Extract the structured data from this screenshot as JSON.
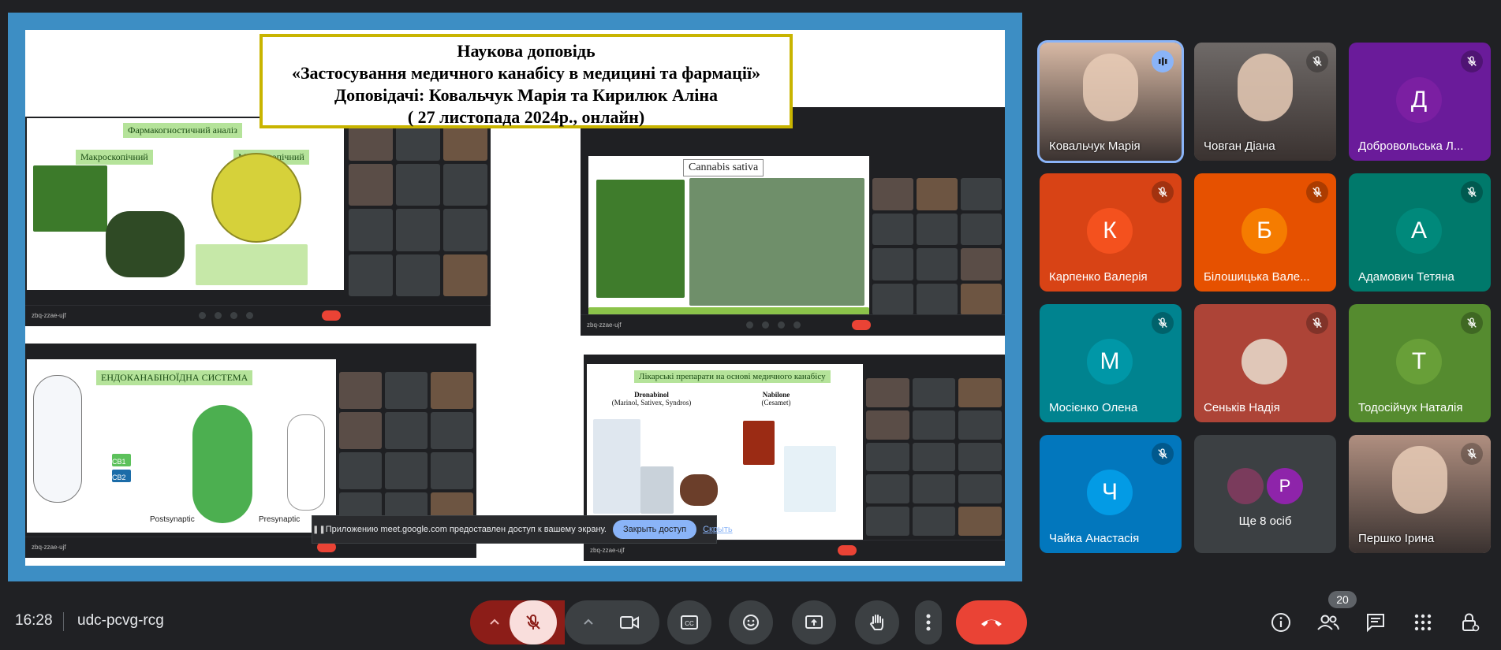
{
  "presentation": {
    "title_lines": [
      "Наукова доповідь",
      "«Застосування медичного канабісу в медицині та фармації»",
      "Доповідачі: Ковальчук Марія та Кирилюк Аліна",
      "( 27 листопада 2024р., онлайн)"
    ],
    "panel_labels": {
      "p1_title": "Фармакогностичний аналіз",
      "p1_macro": "Макроскопічний",
      "p1_micro": "Мікроскопічний",
      "p2_title": "Cannabis sativa",
      "p3_title": "ЕНДОКАНАБІНОЇДНА СИСТЕМА",
      "p3_cb1": "CB1",
      "p3_cb2": "CB2",
      "p3_post": "Postsynaptic",
      "p3_pre": "Presynaptic",
      "p4_title": "Лікарські препарати на основі медичного канабісу",
      "p4_drug1": "Dronabinol",
      "p4_drug1_sub": "(Marinol, Sativex, Syndros)",
      "p4_drug2": "Nabilone",
      "p4_drug2_sub": "(Cesamet)"
    }
  },
  "share_banner": {
    "message": "Приложению meet.google.com предоставлен доступ к вашему экрану.",
    "stop_label": "Закрыть доступ",
    "hide_label": "Скрыть"
  },
  "participants": [
    {
      "name": "Ковальчук Марія",
      "type": "photo",
      "bg": "#d8b9a5",
      "speaking": true
    },
    {
      "name": "Човган Діана",
      "type": "photo",
      "bg": "#6f6a68",
      "muted": true
    },
    {
      "name": "Добровольська Л...",
      "type": "avatar",
      "letter": "Д",
      "tile": "#6a1b9a",
      "circle": "#7b1fa2",
      "muted": true
    },
    {
      "name": "Карпенко Валерія",
      "type": "avatar",
      "letter": "К",
      "tile": "#d84315",
      "circle": "#f4511e",
      "muted": true
    },
    {
      "name": "Білошицька Вале...",
      "type": "avatar",
      "letter": "Б",
      "tile": "#e65100",
      "circle": "#f57c00",
      "muted": true
    },
    {
      "name": "Адамович Тетяна",
      "type": "avatar",
      "letter": "А",
      "tile": "#00796b",
      "circle": "#00897b",
      "muted": true
    },
    {
      "name": "Мосієнко Олена",
      "type": "avatar",
      "letter": "М",
      "tile": "#00838f",
      "circle": "#0097a7",
      "muted": true
    },
    {
      "name": "Сеньків Надія",
      "type": "avatar-photo",
      "tile": "#ad4437",
      "circle": "#e0c7b8",
      "muted": true
    },
    {
      "name": "Тодосійчук Наталія",
      "type": "avatar",
      "letter": "Т",
      "tile": "#558b2f",
      "circle": "#689f38",
      "muted": true
    },
    {
      "name": "Чайка Анастасія",
      "type": "avatar",
      "letter": "Ч",
      "tile": "#0277bd",
      "circle": "#039be5",
      "muted": true
    },
    {
      "name": "Ще 8 осіб",
      "type": "more",
      "tile": "#3c4043",
      "letter2": "Р"
    },
    {
      "name": "Першко Ірина",
      "type": "photo",
      "bg": "#b08f80",
      "muted": true
    }
  ],
  "bottom_bar": {
    "time": "16:28",
    "meeting_code": "udc-pcvg-rcg",
    "people_count": "20"
  },
  "colors": {
    "background": "#202124",
    "stage": "#3d8ec4",
    "end_call": "#ea4335",
    "mic_muted": "#8c1d18",
    "accent": "#8ab4f8"
  },
  "icons": [
    "chevron-up-icon",
    "mic-off-icon",
    "camera-icon",
    "captions-icon",
    "emoji-icon",
    "present-icon",
    "raise-hand-icon",
    "more-icon",
    "end-call-icon",
    "info-icon",
    "people-icon",
    "chat-icon",
    "apps-icon",
    "host-controls-icon"
  ]
}
